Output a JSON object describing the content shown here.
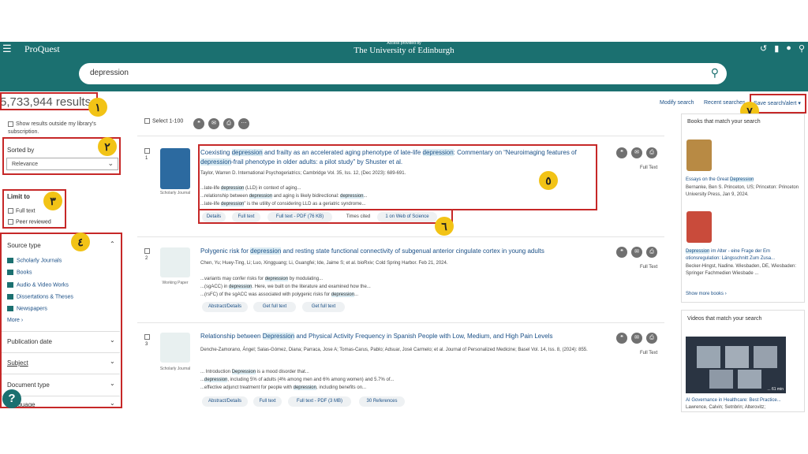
{
  "header": {
    "brand": "ProQuest",
    "access_text": "Access provided by",
    "institution": "The University of Edinburgh",
    "menu_icon": "menu-icon",
    "icons": [
      "history-icon",
      "folder-icon",
      "user-icon",
      "search-icon"
    ]
  },
  "search": {
    "query": "depression"
  },
  "results": {
    "count_text": "5,733,944 results",
    "modify_search": "Modify search",
    "recent_searches": "Recent searches",
    "save_alert": "Save search/alert ▾",
    "select_label": "Select 1-100"
  },
  "badges": [
    "١",
    "٢",
    "٣",
    "٤",
    "٥",
    "٦",
    "٧"
  ],
  "sidebar": {
    "show_outside": "Show results outside my library's subscription.",
    "sorted_by_label": "Sorted by",
    "sort_value": "Relevance",
    "limit_to_label": "Limit to",
    "limit_options": [
      "Full text",
      "Peer reviewed"
    ],
    "source_type_label": "Source type",
    "source_types": [
      "Scholarly Journals",
      "Books",
      "Audio & Video Works",
      "Dissertations & Theses",
      "Newspapers"
    ],
    "more": "More ›",
    "sections": [
      "Publication date",
      "Subject",
      "Document type",
      "Language"
    ]
  },
  "records": [
    {
      "num": "1",
      "type": "Scholarly Journal",
      "title_parts": [
        "Coexisting ",
        "depression",
        " and frailty as an accelerated aging phenotype of late-life ",
        "depression",
        ": Commentary on “Neuroimaging features of ",
        "depression",
        "-frail phenotype in older adults: a pilot study” by Shuster et al."
      ],
      "meta": "Taylor, Warren D.  International Psychogeriatrics; Cambridge Vol. 35, Iss. 12,  (Dec 2023): 689-691.",
      "snippets": [
        [
          "...late-life ",
          "depression",
          " (LLD) in context of aging..."
        ],
        [
          "...relationship between ",
          "depression",
          " and aging is likely bidirectional: ",
          "depression",
          "..."
        ],
        [
          "...late-life ",
          "depression",
          "” is the utility of considering LLD as a geriatric syndrome..."
        ]
      ],
      "actions": [
        "Details",
        "Full text",
        "Full text - PDF (76 KB)",
        "Times cited",
        "1 on Web of Science"
      ],
      "fulltext": "Full Text"
    },
    {
      "num": "2",
      "type": "Working Paper",
      "title_parts": [
        "Polygenic risk for ",
        "depression",
        " and resting state functional connectivity of subgenual anterior cingulate cortex in young adults"
      ],
      "meta": "Chen, Yu; Huey-Ting, Li; Luo, Xingguang; Li, Guangfei; Ide, Jaime S; et al.  bioRxiv; Cold Spring Harbor. Feb 21, 2024.",
      "snippets": [
        [
          "...variants may confer risks for ",
          "depression",
          " by modulating..."
        ],
        [
          "...(sgACC) in ",
          "depression",
          ". Here, we built on the literature and examined how the..."
        ],
        [
          "...(rsFC) of the sgACC was associated with polygenic risks for ",
          "depression",
          "..."
        ]
      ],
      "actions": [
        "Abstract/Details",
        "Get full text",
        "Get full text"
      ],
      "fulltext": "Full Text"
    },
    {
      "num": "3",
      "type": "Scholarly Journal",
      "title_parts": [
        "Relationship between ",
        "Depression",
        " and Physical Activity Frequency in Spanish People with Low, Medium, and High Pain Levels"
      ],
      "meta": "Denche-Zamorano, Ángel; Salas-Gómez, Diana; Parraca, Jose A; Tomas-Carus, Pablo; Adsuar, José Carmelo; et al.  Journal of Personalized Medicine; Basel Vol. 14, Iss. 8,  (2024): 855.",
      "snippets": [
        [
          "... Introduction ",
          "Depression",
          " is a mood disorder that..."
        ],
        [
          "...",
          "depression",
          ", including 5% of adults (4% among men and 6% among women) and 5.7% of..."
        ],
        [
          "...effective adjunct treatment for people with ",
          "depression",
          ", including benefits on..."
        ]
      ],
      "actions": [
        "Abstract/Details",
        "Full text",
        "Full text - PDF (3 MB)",
        "30 References"
      ],
      "fulltext": "Full Text"
    }
  ],
  "right": {
    "books_title": "Books that match your search",
    "book1_title_parts": [
      "Essays on the Great ",
      "Depression"
    ],
    "book1_meta": "Bernanke, Ben S. Princeton, US; Princeton: Princeton University Press, Jan 9, 2024.",
    "book2_title_parts": [
      "Depression",
      " im Alter - eine Frage der Em otionsregulation: Längsschnitt Zum Zusa..."
    ],
    "book2_meta": "Becker-Hingst, Nadine. Wiesbaden, DE, Wiesbaden: Springer Fachmedien Wiesbade ...",
    "show_more": "Show more books ›",
    "videos_title": "Videos that match your search",
    "video_duration": "... 61 min",
    "video_title": "AI Governance in Healthcare: Best Practice...",
    "video_meta": "Lawrence, Calvin; Setnbrin; Alterovitz;"
  },
  "colors": {
    "teal": "#1b7070",
    "link": "#1a4f86",
    "badge": "#f2c316",
    "outline": "#c62828"
  }
}
